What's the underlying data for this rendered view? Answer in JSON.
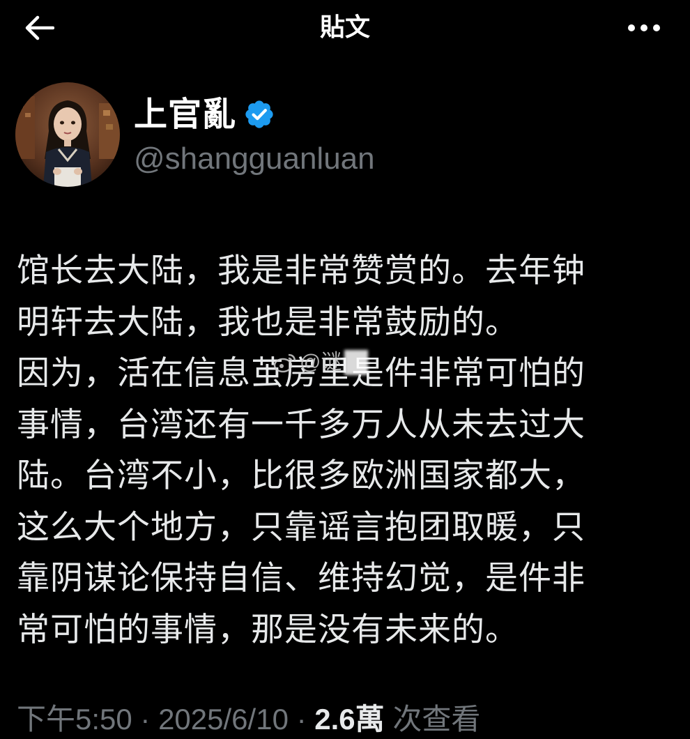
{
  "header": {
    "title": "貼文",
    "back_icon": "arrow-left-icon",
    "more_icon": "more-horizontal-icon"
  },
  "author": {
    "display_name": "上官亂",
    "handle": "@shangguanluan",
    "verified": true,
    "verified_color": "#1d9bf0"
  },
  "tweet": {
    "lines": [
      "馆长去大陆，我是非常赞赏的。去年钟",
      "明轩去大陆，我也是非常鼓励的。",
      "因为，活在信息茧房里是件非常可怕的",
      "事情，台湾还有一千多万人从未去过大",
      "陆。台湾不小，比很多欧洲国家都大，",
      "这么大个地方，只靠谣言抱团取暖，只",
      "靠阴谋论保持自信、维持幻觉，是件非",
      "常可怕的事情，那是没有未来的。"
    ]
  },
  "watermark": {
    "text": "@谜",
    "icon": "weibo-icon"
  },
  "meta": {
    "time": "下午5:50",
    "separator": " · ",
    "date": "2025/6/10",
    "views_count": "2.6萬",
    "views_label": " 次查看"
  },
  "colors": {
    "background": "#000000",
    "text_primary": "#e7e9ea",
    "text_secondary": "#71767b",
    "accent": "#1d9bf0"
  }
}
